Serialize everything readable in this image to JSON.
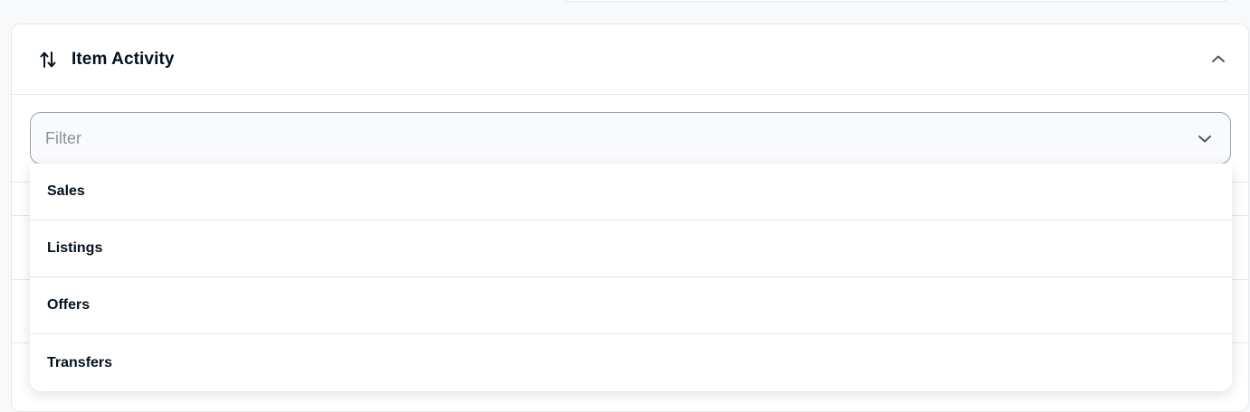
{
  "panel": {
    "title": "Item Activity",
    "header_icon": "arrows-up-down-icon",
    "collapse_icon": "chevron-up-icon"
  },
  "filter": {
    "placeholder": "Filter",
    "chevron_icon": "chevron-down-icon"
  },
  "dropdown": {
    "options": [
      {
        "label": "Sales"
      },
      {
        "label": "Listings"
      },
      {
        "label": "Offers"
      },
      {
        "label": "Transfers"
      }
    ]
  },
  "colors": {
    "text": "#04111d",
    "border": "#e5e8eb",
    "placeholder": "#8a939b",
    "input_bg": "#f9fafc",
    "page_bg": "#f8f9fb"
  }
}
